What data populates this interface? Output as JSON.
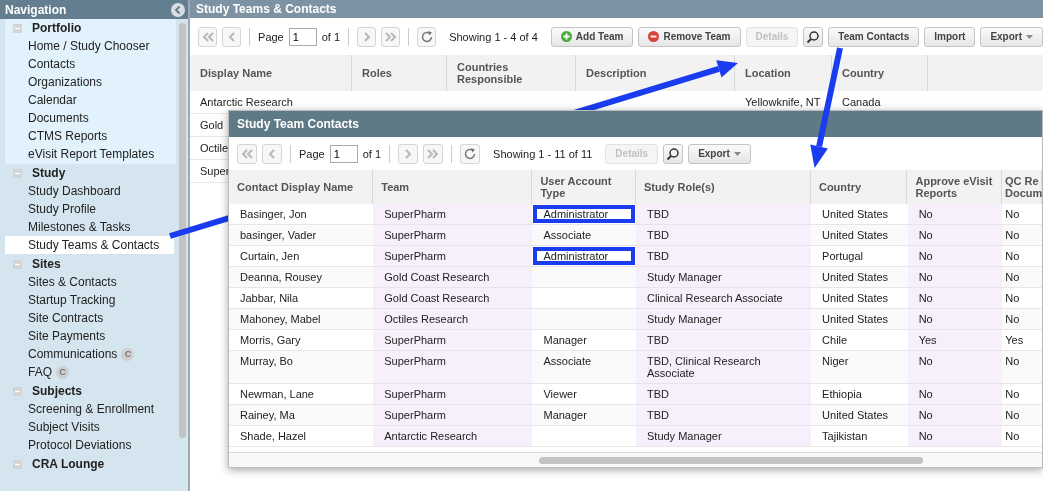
{
  "navigation": {
    "title": "Navigation",
    "sections": [
      {
        "title": "Portfolio",
        "expanded": true,
        "items": [
          {
            "label": "Home / Study Chooser",
            "selected": false
          },
          {
            "label": "Contacts",
            "selected": false
          },
          {
            "label": "Organizations",
            "selected": false
          },
          {
            "label": "Calendar",
            "selected": false
          },
          {
            "label": "Documents",
            "selected": false
          },
          {
            "label": "CTMS Reports",
            "selected": false
          },
          {
            "label": "eVisit Report Templates",
            "selected": false
          }
        ]
      },
      {
        "title": "Study",
        "expanded": true,
        "items": [
          {
            "label": "Study Dashboard",
            "selected": false
          },
          {
            "label": "Study Profile",
            "selected": false
          },
          {
            "label": "Milestones & Tasks",
            "selected": false
          },
          {
            "label": "Study Teams & Contacts",
            "selected": true
          }
        ]
      },
      {
        "title": "Sites",
        "expanded": true,
        "items": [
          {
            "label": "Sites & Contacts",
            "selected": false
          },
          {
            "label": "Startup Tracking",
            "selected": false
          },
          {
            "label": "Site Contracts",
            "selected": false
          },
          {
            "label": "Site Payments",
            "selected": false
          },
          {
            "label": "Communications",
            "selected": false,
            "badge": "C"
          },
          {
            "label": "FAQ",
            "selected": false,
            "badge": "C"
          }
        ]
      },
      {
        "title": "Subjects",
        "expanded": true,
        "items": [
          {
            "label": "Screening & Enrollment",
            "selected": false
          },
          {
            "label": "Subject Visits",
            "selected": false
          },
          {
            "label": "Protocol Deviations",
            "selected": false
          }
        ]
      },
      {
        "title": "CRA Lounge",
        "expanded": true
      }
    ]
  },
  "main": {
    "title": "Study Teams & Contacts",
    "pager": {
      "label": "Page",
      "page": "1",
      "of": "of 1",
      "showing": "Showing 1 - 4 of 4"
    },
    "buttons": [
      {
        "kind": "add",
        "label": "Add Team",
        "disabled": false
      },
      {
        "kind": "remove",
        "label": "Remove Team",
        "disabled": false
      },
      {
        "kind": "plain",
        "label": "Details",
        "disabled": true
      },
      {
        "kind": "search",
        "disabled": false
      },
      {
        "kind": "plain",
        "label": "Team Contacts",
        "disabled": false
      },
      {
        "kind": "plain",
        "label": "Import",
        "disabled": false
      },
      {
        "kind": "menu",
        "label": "Export",
        "disabled": false
      }
    ],
    "table": {
      "columns": [
        "Display Name",
        "Roles",
        "Countries Responsible",
        "Description",
        "Location",
        "Country"
      ],
      "rows": [
        [
          "Antarctic Research",
          "",
          "",
          "",
          "Yellowknife, NT",
          "Canada"
        ],
        [
          "Gold"
        ],
        [
          "Octile"
        ],
        [
          "Super"
        ]
      ]
    }
  },
  "dialog": {
    "title": "Study Team Contacts",
    "pager": {
      "label": "Page",
      "page": "1",
      "of": "of 1",
      "showing": "Showing 1 - 11 of 11"
    },
    "buttons": [
      {
        "kind": "plain",
        "label": "Details",
        "disabled": true
      },
      {
        "kind": "search",
        "disabled": false
      },
      {
        "kind": "menu",
        "label": "Export",
        "disabled": false
      }
    ],
    "table": {
      "columns": [
        {
          "label": "Contact Display Name",
          "tinted": false
        },
        {
          "label": "Team",
          "tinted": true
        },
        {
          "label": "User Account Type",
          "tinted": false
        },
        {
          "label": "Study Role(s)",
          "tinted": true
        },
        {
          "label": "Country",
          "tinted": false
        },
        {
          "label": "Approve eVisit Reports",
          "tinted": true
        },
        {
          "label": "QC Re Docum",
          "tinted": false
        }
      ],
      "rows": [
        {
          "cells": [
            "Basinger, Jon",
            "SuperPharm",
            "Administrator",
            "TBD",
            "United States",
            "No",
            "No"
          ],
          "highlighted": true
        },
        {
          "cells": [
            "basinger, Vader",
            "SuperPharm",
            "Associate",
            "TBD",
            "United States",
            "No",
            "No"
          ],
          "highlighted": false
        },
        {
          "cells": [
            "Curtain, Jen",
            "SuperPharm",
            "Administrator",
            "TBD",
            "Portugal",
            "No",
            "No"
          ],
          "highlighted": true
        },
        {
          "cells": [
            "Deanna, Rousey",
            "Gold Coast Research",
            "",
            "Study Manager",
            "United States",
            "No",
            "No"
          ],
          "highlighted": false
        },
        {
          "cells": [
            "Jabbar, Nila",
            "Gold Coast Research",
            "",
            "Clinical Research Associate",
            "United States",
            "No",
            "No"
          ],
          "highlighted": false
        },
        {
          "cells": [
            "Mahoney, Mabel",
            "Octiles Research",
            "",
            "Study Manager",
            "United States",
            "No",
            "No"
          ],
          "highlighted": false
        },
        {
          "cells": [
            "Morris, Gary",
            "SuperPharm",
            "Manager",
            "TBD",
            "Chile",
            "Yes",
            "Yes"
          ],
          "highlighted": false
        },
        {
          "cells": [
            "Murray, Bo",
            "SuperPharm",
            "Associate",
            "TBD, Clinical Research Associate",
            "Niger",
            "No",
            "No"
          ],
          "highlighted": false
        },
        {
          "cells": [
            "Newman, Lane",
            "SuperPharm",
            "Viewer",
            "TBD",
            "Ethiopia",
            "No",
            "No"
          ],
          "highlighted": false
        },
        {
          "cells": [
            "Rainey, Ma",
            "SuperPharm",
            "Manager",
            "TBD",
            "United States",
            "No",
            "No"
          ],
          "highlighted": false
        },
        {
          "cells": [
            "Shade, Hazel",
            "Antarctic Research",
            "",
            "Study Manager",
            "Tajikistan",
            "No",
            "No"
          ],
          "highlighted": false
        }
      ]
    }
  }
}
